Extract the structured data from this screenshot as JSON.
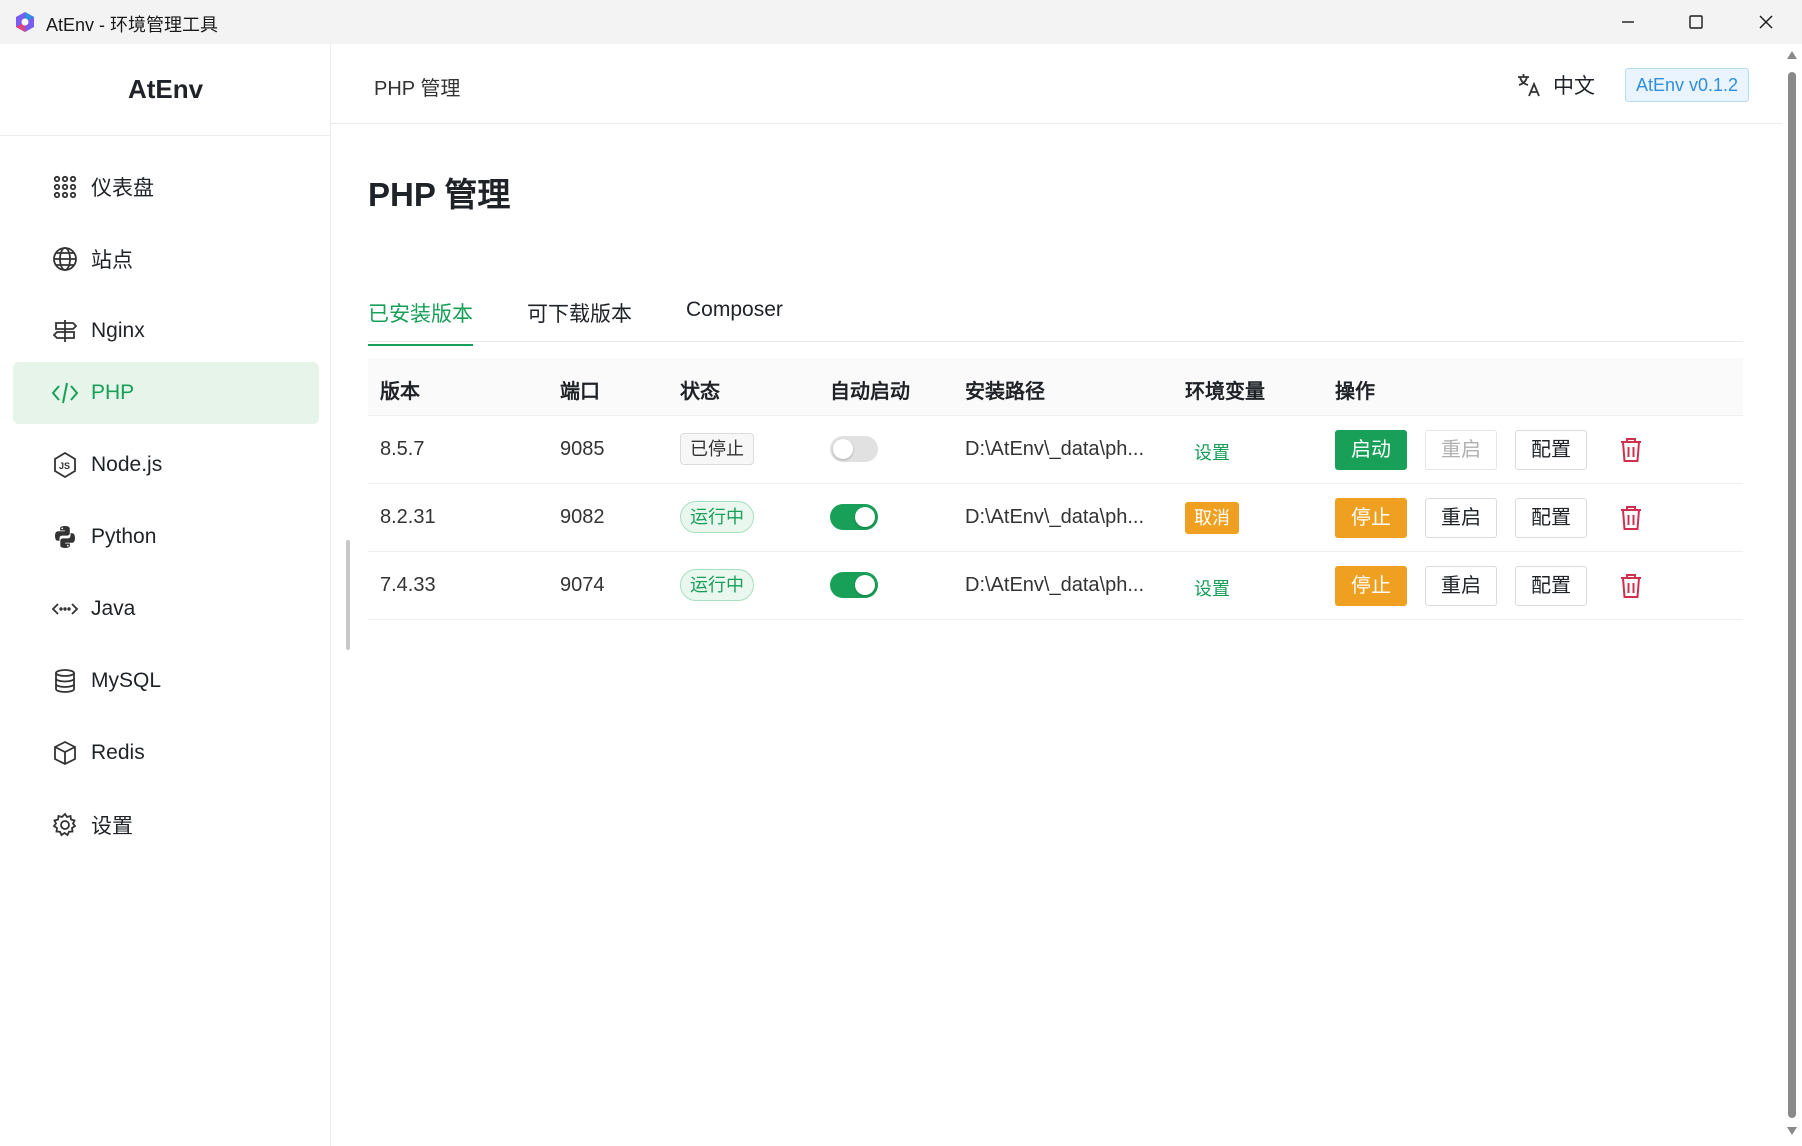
{
  "window": {
    "title": "AtEnv - 环境管理工具"
  },
  "sidebar": {
    "brand": "AtEnv",
    "items": [
      {
        "label": "仪表盘",
        "icon": "dashboard-grid-icon"
      },
      {
        "label": "站点",
        "icon": "globe-icon"
      },
      {
        "label": "Nginx",
        "icon": "signpost-icon"
      },
      {
        "label": "PHP",
        "icon": "code-icon",
        "active": true
      },
      {
        "label": "Node.js",
        "icon": "nodejs-icon"
      },
      {
        "label": "Python",
        "icon": "python-icon"
      },
      {
        "label": "Java",
        "icon": "java-arrows-icon"
      },
      {
        "label": "MySQL",
        "icon": "database-icon"
      },
      {
        "label": "Redis",
        "icon": "cube-icon"
      },
      {
        "label": "设置",
        "icon": "gear-icon"
      }
    ]
  },
  "header": {
    "breadcrumb": "PHP 管理",
    "language": "中文",
    "version": "AtEnv v0.1.2"
  },
  "main": {
    "title": "PHP 管理",
    "tabs": [
      {
        "label": "已安装版本",
        "active": true
      },
      {
        "label": "可下载版本"
      },
      {
        "label": "Composer"
      }
    ],
    "table": {
      "columns": [
        "版本",
        "端口",
        "状态",
        "自动启动",
        "安装路径",
        "环境变量",
        "操作"
      ],
      "rows": [
        {
          "version": "8.5.7",
          "port": "9085",
          "status": "已停止",
          "status_kind": "stopped",
          "auto_start": false,
          "path": "D:\\AtEnv\\_data\\ph...",
          "env": "设置",
          "env_kind": "set",
          "action_primary": "启动",
          "action_primary_kind": "start",
          "restart": "重启",
          "restart_disabled": true,
          "config": "配置"
        },
        {
          "version": "8.2.31",
          "port": "9082",
          "status": "运行中",
          "status_kind": "running",
          "auto_start": true,
          "path": "D:\\AtEnv\\_data\\ph...",
          "env": "取消",
          "env_kind": "cancel",
          "action_primary": "停止",
          "action_primary_kind": "stop",
          "restart": "重启",
          "restart_disabled": false,
          "config": "配置"
        },
        {
          "version": "7.4.33",
          "port": "9074",
          "status": "运行中",
          "status_kind": "running",
          "auto_start": true,
          "path": "D:\\AtEnv\\_data\\ph...",
          "env": "设置",
          "env_kind": "set",
          "action_primary": "停止",
          "action_primary_kind": "stop",
          "restart": "重启",
          "restart_disabled": false,
          "config": "配置"
        }
      ]
    }
  },
  "colors": {
    "accent": "#18a058",
    "warning": "#f0a020",
    "danger": "#d03050",
    "version_badge": "#2f8fdd"
  }
}
